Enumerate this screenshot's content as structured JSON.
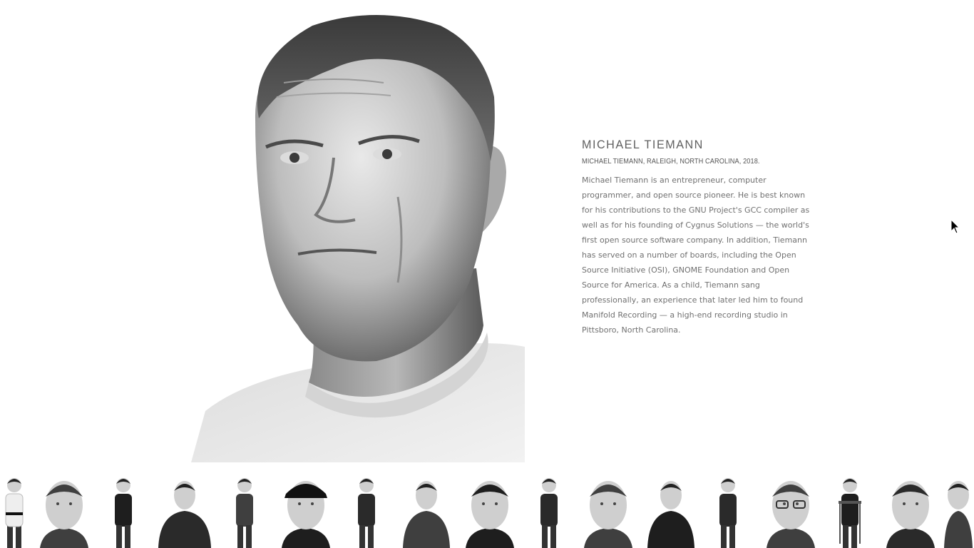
{
  "portrait": {
    "subject": "Michael Tiemann"
  },
  "bio": {
    "name": "MICHAEL TIEMANN",
    "caption": "MICHAEL TIEMANN, RALEIGH, NORTH CAROLINA, 2018.",
    "description": "Michael Tiemann is an entrepreneur, computer programmer, and open source pioneer. He is best known for his contributions to the GNU Project's GCC compiler as well as for his founding of Cygnus Solutions — the world's first open source software company. In addition, Tiemann has served on a number of boards, including the Open Source Initiative (OSI), GNOME Foundation and Open Source for America. As a child, Tiemann sang professionally, an experience that later led him to found Manifold Recording — a high-end recording studio in Pittsboro, North Carolina."
  },
  "thumbnails": {
    "count": 18,
    "items": [
      {
        "kind": "full-body",
        "icon": "person-karate-icon"
      },
      {
        "kind": "close-up",
        "icon": "person-portrait-icon"
      },
      {
        "kind": "full-body",
        "icon": "person-standing-icon"
      },
      {
        "kind": "half-body",
        "icon": "person-seated-icon"
      },
      {
        "kind": "full-body",
        "icon": "person-standing-icon"
      },
      {
        "kind": "close-up",
        "icon": "person-cap-icon"
      },
      {
        "kind": "full-body",
        "icon": "person-standing-icon"
      },
      {
        "kind": "half-body",
        "icon": "person-portrait-icon"
      },
      {
        "kind": "close-up",
        "icon": "person-portrait-icon"
      },
      {
        "kind": "full-body",
        "icon": "person-standing-icon"
      },
      {
        "kind": "close-up",
        "icon": "person-portrait-icon"
      },
      {
        "kind": "half-body",
        "icon": "person-standing-icon"
      },
      {
        "kind": "full-body",
        "icon": "person-standing-icon"
      },
      {
        "kind": "close-up",
        "icon": "person-glasses-icon"
      },
      {
        "kind": "full-body",
        "icon": "person-chair-icon"
      },
      {
        "kind": "close-up",
        "icon": "person-portrait-icon"
      },
      {
        "kind": "half-body",
        "icon": "person-portrait-icon"
      }
    ]
  },
  "colors": {
    "background": "#ffffff",
    "heading": "#5f5f5f",
    "body_text": "#707070"
  }
}
